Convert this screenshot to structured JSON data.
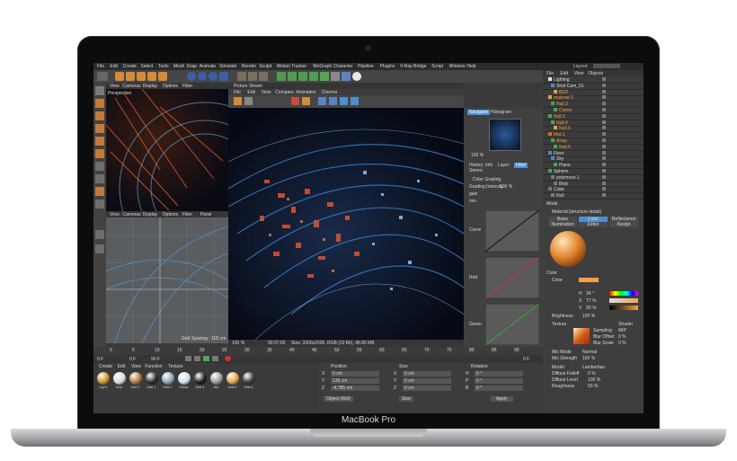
{
  "device": {
    "brand": "MacBook Pro"
  },
  "menubar": {
    "items": [
      "File",
      "Edit",
      "Create",
      "Select",
      "Tools",
      "Mesh",
      "Snap",
      "Animate",
      "Simulate",
      "Render",
      "Sculpt",
      "Motion Tracker",
      "MoGraph",
      "Character",
      "Pipeline",
      "Plugins",
      "V-Ray Bridge",
      "Script",
      "Window",
      "Help"
    ],
    "layout_label": "Layout:"
  },
  "top_view": {
    "menu": [
      "View",
      "Cameras",
      "Display",
      "Options",
      "Filter"
    ],
    "label": "Perspective"
  },
  "bottom_view": {
    "menu": [
      "View",
      "Cameras",
      "Display",
      "Options",
      "Filter",
      "Panel"
    ],
    "label": "Grid Spacing : 100 cm"
  },
  "picture_viewer": {
    "title": "Picture Viewer",
    "menu": [
      "File",
      "Edit",
      "View",
      "Compare",
      "Animation",
      "Cinema"
    ],
    "zoom": "100 %",
    "time": "00:07:00",
    "size_info": "Size: 2000x2000, RGB (32 Bit), 48.80 MB"
  },
  "navigator": {
    "tabs": [
      "Navigator",
      "Histogram"
    ],
    "zoom": "100 %",
    "subtabs": [
      "History",
      "Info",
      "Layer",
      "Filter"
    ],
    "stereo": "Stereo",
    "color_grading": "Color Grading",
    "grading_intensity_label": "Grading Intensity",
    "grading_intensity": "100 %",
    "gain_label": "gain",
    "mix_label": "mix",
    "curve_label": "Curve",
    "red_label": "Red",
    "green_label": "Green"
  },
  "timeline": {
    "frame": "0 F",
    "fields": [
      "0 F",
      "90 F"
    ],
    "ticks": [
      "0",
      "5",
      "10",
      "15",
      "20",
      "25",
      "30",
      "35",
      "40",
      "45",
      "50",
      "55",
      "60",
      "65",
      "70",
      "75",
      "80",
      "85",
      "90"
    ],
    "end": "0 F"
  },
  "materials": {
    "tabs": [
      "Create",
      "Edit",
      "View",
      "Function",
      "Texture"
    ],
    "items": [
      "Light",
      "Mat",
      "Mat.3",
      "Mat.1",
      "Mat.2",
      "Glass",
      "Mat.4",
      "Alu",
      "Mat.5",
      "Mat.6"
    ]
  },
  "coordinates": {
    "headers": [
      "Position",
      "Size",
      "Rotation"
    ],
    "rows": [
      [
        "X",
        "0 cm",
        "X",
        "0 cm",
        "H",
        "0 °"
      ],
      [
        "Y",
        "135 cm",
        "Y",
        "0 cm",
        "P",
        "0 °"
      ],
      [
        "Z",
        "-4.785 cm",
        "Z",
        "0 cm",
        "B",
        "0 °"
      ]
    ],
    "mode": "Object (Rel)",
    "size_mode": "Size",
    "apply": "Apply"
  },
  "objects": {
    "menu": [
      "File",
      "Edit",
      "View",
      "Objects"
    ],
    "items": [
      "Lighting",
      "Shot Cam_01",
      "BED",
      "mainnet.1",
      "Null.3",
      "Cloner",
      "Null.2",
      "Null.4",
      "Null.5",
      "Mat.1",
      "Array",
      "Null.6",
      "Floor",
      "Sky",
      "Plane",
      "Sphere",
      "polymesh.1",
      "Blob",
      "Cube",
      "Null"
    ]
  },
  "attributes": {
    "mode": "Mode",
    "title": "Material [structure detail]",
    "tabs": [
      "Basic",
      "Color",
      "Reflectance",
      "Illumination",
      "Editor",
      "Assign"
    ],
    "color_section": "Color",
    "color_label": "Color",
    "h_label": "H",
    "h_val": "34 °",
    "s_label": "S",
    "s_val": "77 %",
    "v_label": "V",
    "v_val": "90 %",
    "brightness_label": "Brightness",
    "brightness_val": "100 %",
    "texture_label": "Texture",
    "texture_btn": "Shader",
    "sampling_label": "Sampling",
    "sampling_val": "MIP",
    "blur_offset_label": "Blur Offset",
    "blur_offset_val": "0 %",
    "blur_scale_label": "Blur Scale",
    "blur_scale_val": "0 %",
    "mix_mode_label": "Mix Mode",
    "mix_mode_val": "Normal",
    "mix_strength_label": "Mix Strength",
    "mix_strength_val": "100 %",
    "model_label": "Model",
    "model_val": "Lambertian",
    "diffuse_falloff_label": "Diffuse Falloff",
    "diffuse_falloff_val": "0 %",
    "diffuse_level_label": "Diffuse Level",
    "diffuse_level_val": "100 %",
    "roughness_label": "Roughness",
    "roughness_val": "50 %"
  },
  "colors": {
    "accent": "#4d8fd6",
    "viewport_bg": "#0a1020",
    "grid_bg": "#55585b",
    "orange": "#e07a28"
  }
}
